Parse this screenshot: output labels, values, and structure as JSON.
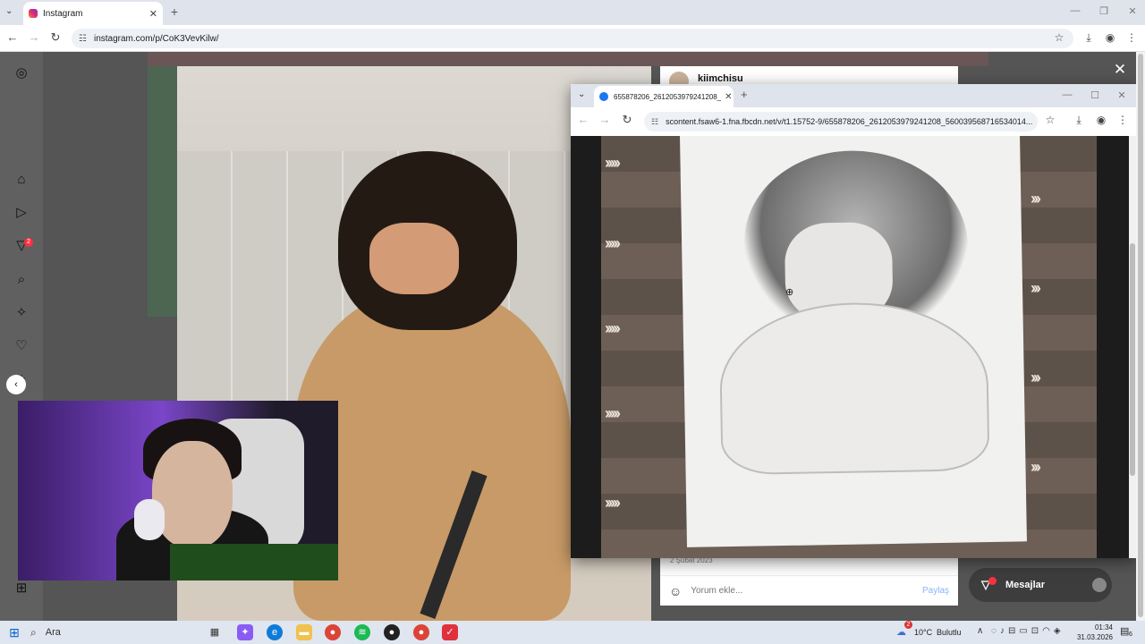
{
  "browser": {
    "tab_title": "Instagram",
    "url": "instagram.com/p/CoK3VevKilw/",
    "new_tab_label": "+"
  },
  "instagram": {
    "post_username": "kiimchisu",
    "post_date": "2 Şubat 2023",
    "comment_placeholder": "Yorum ekle...",
    "share_label": "Paylaş",
    "messages_label": "Mesajlar",
    "notification_count": "2",
    "messages_badge_count": "2",
    "close_icon": "close-icon"
  },
  "popup_window": {
    "tab_title": "655878206_2612053979241208_",
    "url": "scontent.fsaw6-1.fna.fbcdn.net/v/t1.15752-9/655878206_2612053979241208_560039568716534014..."
  },
  "taskbar": {
    "search_label": "Ara",
    "weather_badge": "2",
    "temperature": "10°C",
    "weather": "Bulutlu",
    "time": "01:34",
    "date": "31.03.2026",
    "notification_count": "6"
  },
  "colors": {
    "accent": "#0a63c9",
    "instagram_badge": "#ff3040",
    "share_link": "#85b6f5"
  }
}
